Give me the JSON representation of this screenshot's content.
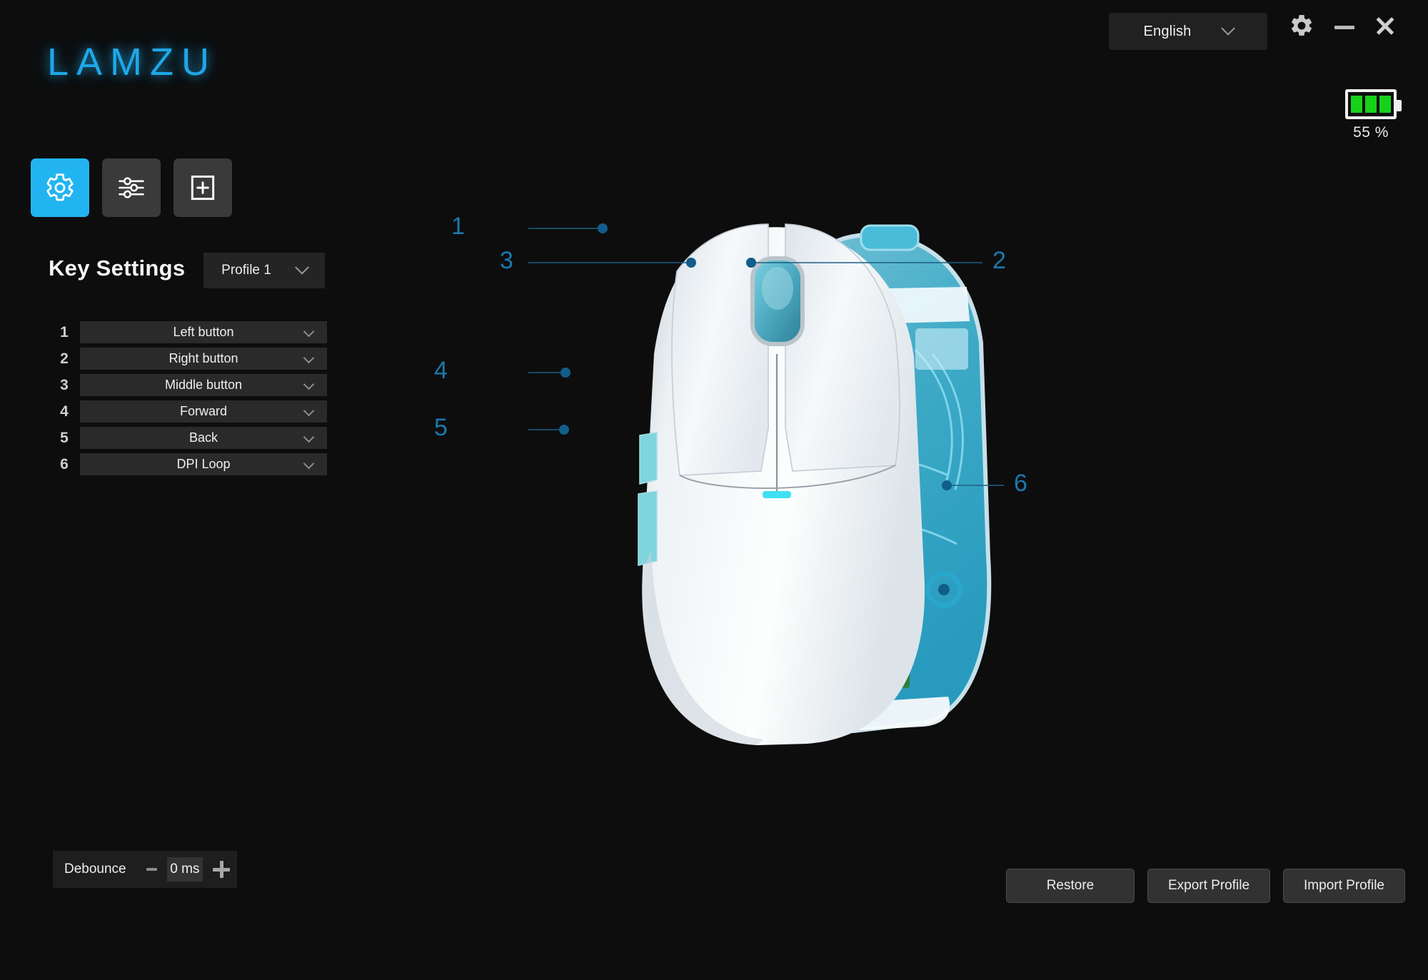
{
  "app": {
    "brand": "LAMZU"
  },
  "titlebar": {
    "language": {
      "value": "English",
      "chevron_icon": "chevron-down-icon"
    },
    "settings_icon": "gear-icon",
    "minimize_icon": "minimize-icon",
    "close_icon": "close-icon"
  },
  "battery": {
    "percent_label": "55 %",
    "level": 55,
    "bars": 3,
    "color": "#16d21a"
  },
  "tabs": [
    {
      "name": "key-settings",
      "icon": "gear-icon",
      "active": true
    },
    {
      "name": "performance",
      "icon": "sliders-icon",
      "active": false
    },
    {
      "name": "add-profile",
      "icon": "add-page-icon",
      "active": false
    }
  ],
  "key_settings": {
    "title": "Key Settings",
    "profile": {
      "value": "Profile 1",
      "chevron_icon": "chevron-down-icon"
    },
    "rows": [
      {
        "number": "1",
        "assignment": "Left button"
      },
      {
        "number": "2",
        "assignment": "Right button"
      },
      {
        "number": "3",
        "assignment": "Middle button"
      },
      {
        "number": "4",
        "assignment": "Forward"
      },
      {
        "number": "5",
        "assignment": "Back"
      },
      {
        "number": "6",
        "assignment": "DPI Loop"
      }
    ]
  },
  "debounce": {
    "label": "Debounce",
    "value": "0 ms",
    "minus_icon": "minus-icon",
    "plus_icon": "plus-icon"
  },
  "actions": {
    "restore": "Restore",
    "export_profile": "Export Profile",
    "import_profile": "Import Profile"
  },
  "diagram": {
    "callouts": [
      {
        "number": "1",
        "target": "left-button"
      },
      {
        "number": "2",
        "target": "right-button"
      },
      {
        "number": "3",
        "target": "middle-button-scroll-wheel"
      },
      {
        "number": "4",
        "target": "forward-side-button"
      },
      {
        "number": "5",
        "target": "back-side-button"
      },
      {
        "number": "6",
        "target": "dpi-button"
      }
    ]
  },
  "colors": {
    "accent": "#22b4f0",
    "logo": "#1ea7e8",
    "callout": "#1c78ad",
    "background": "#0d0d0d",
    "battery_green": "#16d21a"
  }
}
